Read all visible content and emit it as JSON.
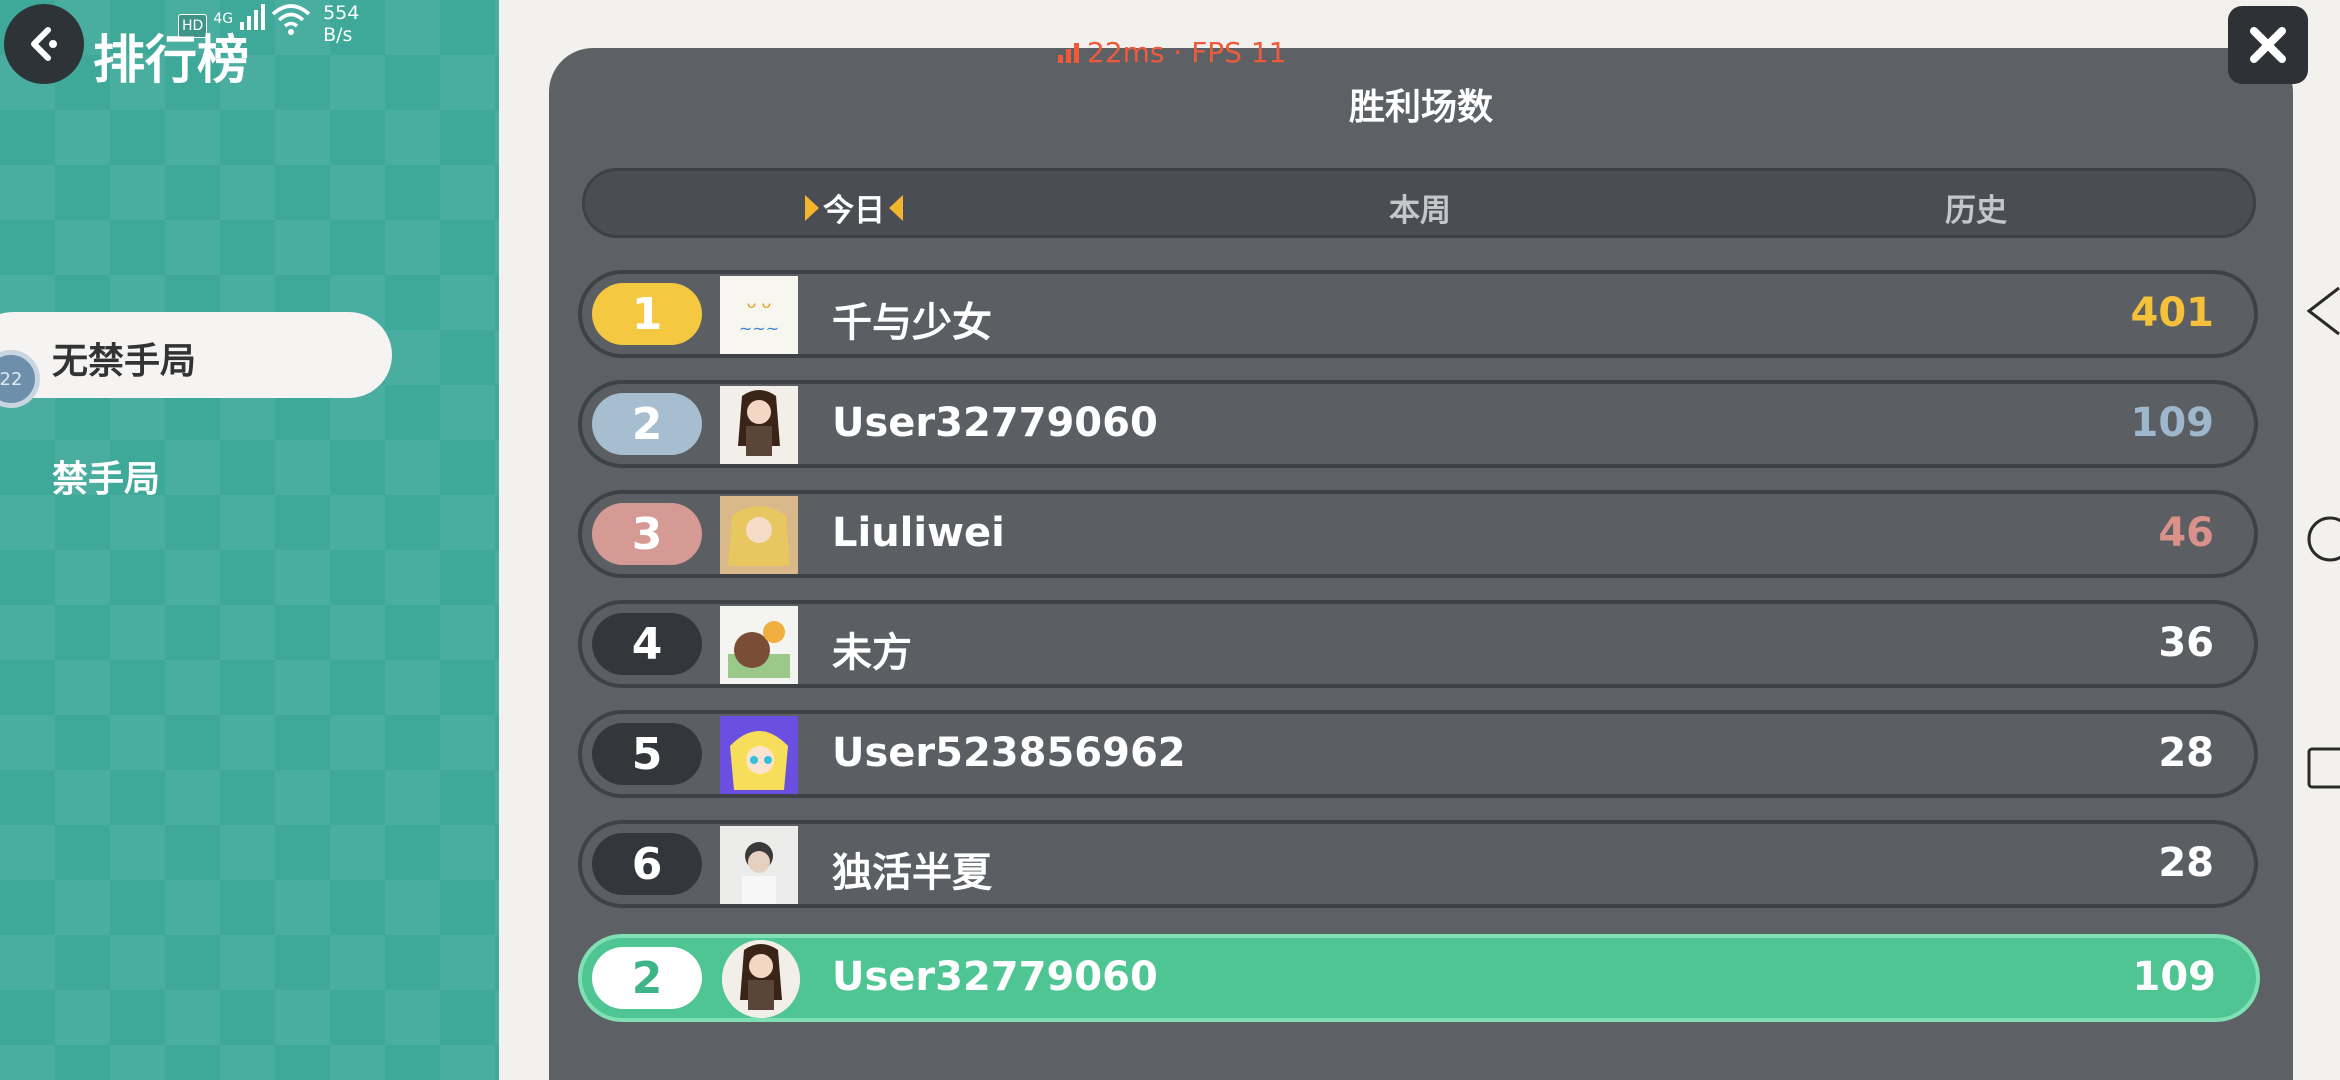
{
  "header": {
    "title": "排行榜",
    "back_icon": "back-arrow-icon"
  },
  "status_bar": {
    "hd": "HD",
    "network": "4G",
    "speed_value": "554",
    "speed_unit": "B/s"
  },
  "perf": {
    "text": "22ms · FPS 11"
  },
  "sidebar": {
    "items": [
      {
        "label": "无禁手局",
        "active": true
      },
      {
        "label": "禁手局",
        "active": false
      }
    ],
    "badge": "22"
  },
  "panel": {
    "title": "胜利场数"
  },
  "tabs": [
    {
      "label": "今日",
      "active": true
    },
    {
      "label": "本周",
      "active": false
    },
    {
      "label": "历史",
      "active": false
    }
  ],
  "leaderboard": [
    {
      "rank": "1",
      "name": "千与少女",
      "score": "401",
      "rank_color": "#f5c842",
      "score_color": "#f5c03a"
    },
    {
      "rank": "2",
      "name": "User32779060",
      "score": "109",
      "rank_color": "#a7bed1",
      "score_color": "#9fb7cc"
    },
    {
      "rank": "3",
      "name": "Liuliwei",
      "score": "46",
      "rank_color": "#d69a94",
      "score_color": "#d9918a"
    },
    {
      "rank": "4",
      "name": "未方",
      "score": "36",
      "rank_color": "#33373b",
      "score_color": "#ffffff"
    },
    {
      "rank": "5",
      "name": "User523856962",
      "score": "28",
      "rank_color": "#33373b",
      "score_color": "#ffffff"
    },
    {
      "rank": "6",
      "name": "独活半夏",
      "score": "28",
      "rank_color": "#33373b",
      "score_color": "#ffffff"
    }
  ],
  "self": {
    "rank": "2",
    "name": "User32779060",
    "score": "109"
  },
  "colors": {
    "sidebar_bg": "#3ea999",
    "panel_bg": "#5d6166",
    "self_row": "#4ec593",
    "accent": "#f4b52e"
  }
}
